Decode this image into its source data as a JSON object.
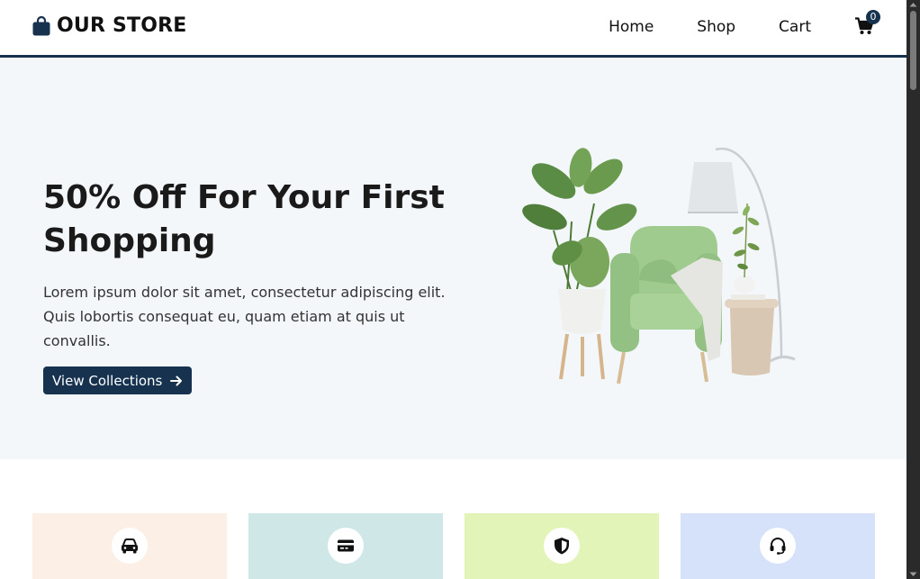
{
  "header": {
    "logo_text": "OUR STORE",
    "nav": [
      {
        "label": "Home"
      },
      {
        "label": "Shop"
      },
      {
        "label": "Cart"
      }
    ],
    "cart_count": "0"
  },
  "hero": {
    "title": "50% Off For Your First Shopping",
    "text": "Lorem ipsum dolor sit amet, consectetur adipiscing elit. Quis lobortis consequat eu, quam etiam at quis ut convallis.",
    "button_label": "View Collections"
  },
  "features": [
    {
      "icon": "car-icon",
      "color": "#fcefe6"
    },
    {
      "icon": "credit-card-icon",
      "color": "#cfe8e7"
    },
    {
      "icon": "shield-icon",
      "color": "#e2f4b7"
    },
    {
      "icon": "headset-icon",
      "color": "#d5e2fa"
    }
  ],
  "colors": {
    "brand": "#16324f",
    "hero_bg": "#f4f7fa"
  }
}
